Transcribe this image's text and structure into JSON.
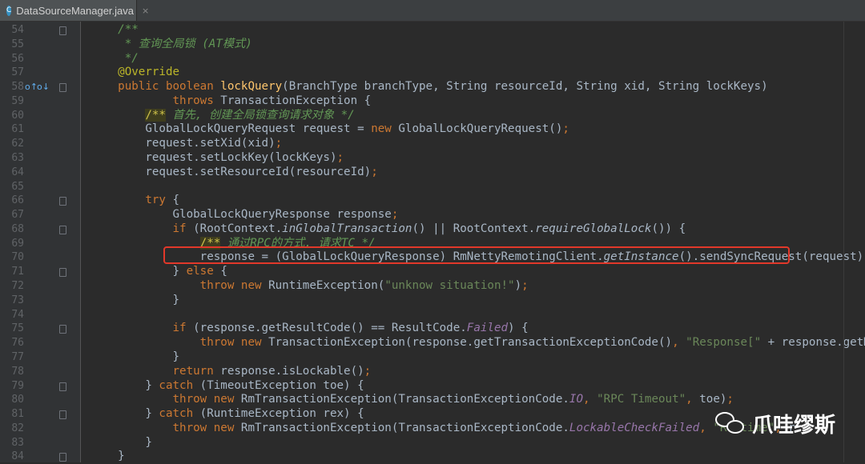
{
  "tab": {
    "icon": "java-class-icon",
    "icon_letter": "C",
    "filename": "DataSourceManager.java",
    "close": "×"
  },
  "gutter": {
    "line_numbers": [
      "54",
      "55",
      "56",
      "57",
      "58",
      "59",
      "60",
      "61",
      "62",
      "63",
      "64",
      "65",
      "66",
      "67",
      "68",
      "69",
      "70",
      "71",
      "72",
      "73",
      "74",
      "75",
      "76",
      "77",
      "78",
      "79",
      "80",
      "81",
      "82",
      "83",
      "84"
    ],
    "line58_icons": [
      "o↑",
      "o↓"
    ]
  },
  "code": {
    "lines": [
      [
        {
          "t": "    /**",
          "c": "cm"
        }
      ],
      [
        {
          "t": "     * 查询全局锁 (AT模式)",
          "c": "cm"
        }
      ],
      [
        {
          "t": "     */",
          "c": "cm"
        }
      ],
      [
        {
          "t": "    @Override",
          "c": "ann"
        }
      ],
      [
        {
          "t": "    public boolean ",
          "c": "kw"
        },
        {
          "t": "lockQuery",
          "c": "fn"
        },
        {
          "t": "(BranchType branchType, String resourceId, String xid, String lockKeys)",
          "c": ""
        }
      ],
      [
        {
          "t": "            throws ",
          "c": "kw"
        },
        {
          "t": "TransactionException {",
          "c": ""
        }
      ],
      [
        {
          "t": "        ",
          "c": ""
        },
        {
          "t": "/**",
          "c": "cm hl"
        },
        {
          "t": " 首先, 创建全局锁查询请求对象 */",
          "c": "cm"
        }
      ],
      [
        {
          "t": "        GlobalLockQueryRequest request = ",
          "c": ""
        },
        {
          "t": "new ",
          "c": "kw"
        },
        {
          "t": "GlobalLockQueryRequest()",
          "c": ""
        },
        {
          "t": ";",
          "c": "kw"
        }
      ],
      [
        {
          "t": "        request.setXid(xid)",
          "c": ""
        },
        {
          "t": ";",
          "c": "kw"
        }
      ],
      [
        {
          "t": "        request.setLockKey(lockKeys)",
          "c": ""
        },
        {
          "t": ";",
          "c": "kw"
        }
      ],
      [
        {
          "t": "        request.setResourceId(resourceId)",
          "c": ""
        },
        {
          "t": ";",
          "c": "kw"
        }
      ],
      [
        {
          "t": "",
          "c": ""
        }
      ],
      [
        {
          "t": "        try ",
          "c": "kw"
        },
        {
          "t": "{",
          "c": ""
        }
      ],
      [
        {
          "t": "            GlobalLockQueryResponse response",
          "c": ""
        },
        {
          "t": ";",
          "c": "kw"
        }
      ],
      [
        {
          "t": "            if ",
          "c": "kw"
        },
        {
          "t": "(RootContext.",
          "c": ""
        },
        {
          "t": "inGlobalTransaction",
          "c": "stt"
        },
        {
          "t": "() || RootContext.",
          "c": ""
        },
        {
          "t": "requireGlobalLock",
          "c": "stt"
        },
        {
          "t": "()) {",
          "c": ""
        }
      ],
      [
        {
          "t": "                ",
          "c": ""
        },
        {
          "t": "/**",
          "c": "cm hl"
        },
        {
          "t": " 通过RPC的方式, 请求TC */",
          "c": "cm"
        }
      ],
      [
        {
          "t": "                response = (GlobalLockQueryResponse) RmNettyRemotingClient.",
          "c": ""
        },
        {
          "t": "getInstance",
          "c": "stt"
        },
        {
          "t": "().sendSyncRequest(request)",
          "c": ""
        },
        {
          "t": ";",
          "c": "kw"
        }
      ],
      [
        {
          "t": "            } ",
          "c": ""
        },
        {
          "t": "else ",
          "c": "kw"
        },
        {
          "t": "{",
          "c": ""
        }
      ],
      [
        {
          "t": "                throw new ",
          "c": "kw"
        },
        {
          "t": "RuntimeException(",
          "c": ""
        },
        {
          "t": "\"unknow situation!\"",
          "c": "st"
        },
        {
          "t": ")",
          "c": ""
        },
        {
          "t": ";",
          "c": "kw"
        }
      ],
      [
        {
          "t": "            }",
          "c": ""
        }
      ],
      [
        {
          "t": "",
          "c": ""
        }
      ],
      [
        {
          "t": "            if ",
          "c": "kw"
        },
        {
          "t": "(response.getResultCode() == ResultCode.",
          "c": ""
        },
        {
          "t": "Failed",
          "c": "fld"
        },
        {
          "t": ") {",
          "c": ""
        }
      ],
      [
        {
          "t": "                throw new ",
          "c": "kw"
        },
        {
          "t": "TransactionException(response.getTransactionExceptionCode()",
          "c": ""
        },
        {
          "t": ", ",
          "c": "kw"
        },
        {
          "t": "\"Response[\"",
          "c": "st"
        },
        {
          "t": " + response.getMsg() + ",
          "c": ""
        },
        {
          "t": "\"]\"",
          "c": "st"
        },
        {
          "t": ");",
          "c": "kw"
        }
      ],
      [
        {
          "t": "            }",
          "c": ""
        }
      ],
      [
        {
          "t": "            return ",
          "c": "kw"
        },
        {
          "t": "response.isLockable()",
          "c": ""
        },
        {
          "t": ";",
          "c": "kw"
        }
      ],
      [
        {
          "t": "        } ",
          "c": ""
        },
        {
          "t": "catch ",
          "c": "kw"
        },
        {
          "t": "(TimeoutException toe) {",
          "c": ""
        }
      ],
      [
        {
          "t": "            throw new ",
          "c": "kw"
        },
        {
          "t": "RmTransactionException(TransactionExceptionCode.",
          "c": ""
        },
        {
          "t": "IO",
          "c": "fld"
        },
        {
          "t": ", ",
          "c": "kw"
        },
        {
          "t": "\"RPC Timeout\"",
          "c": "st"
        },
        {
          "t": ", ",
          "c": "kw"
        },
        {
          "t": "toe)",
          "c": ""
        },
        {
          "t": ";",
          "c": "kw"
        }
      ],
      [
        {
          "t": "        } ",
          "c": ""
        },
        {
          "t": "catch ",
          "c": "kw"
        },
        {
          "t": "(RuntimeException rex) {",
          "c": ""
        }
      ],
      [
        {
          "t": "            throw new ",
          "c": "kw"
        },
        {
          "t": "RmTransactionException(TransactionExceptionCode.",
          "c": ""
        },
        {
          "t": "LockableCheckFailed",
          "c": "fld"
        },
        {
          "t": ", ",
          "c": "kw"
        },
        {
          "t": "\"Runtime\"",
          "c": "st"
        },
        {
          "t": ", ",
          "c": "kw"
        },
        {
          "t": "r",
          "c": ""
        }
      ],
      [
        {
          "t": "        }",
          "c": ""
        }
      ],
      [
        {
          "t": "    }",
          "c": ""
        }
      ]
    ]
  },
  "watermark": {
    "icon": "wechat-icon",
    "text": "爪哇缪斯"
  },
  "colors": {
    "highlight_box": "#e2382a",
    "keyword": "#cc7832",
    "comment": "#629755",
    "method": "#ffc66d",
    "string": "#6a8759",
    "field": "#9876aa"
  }
}
